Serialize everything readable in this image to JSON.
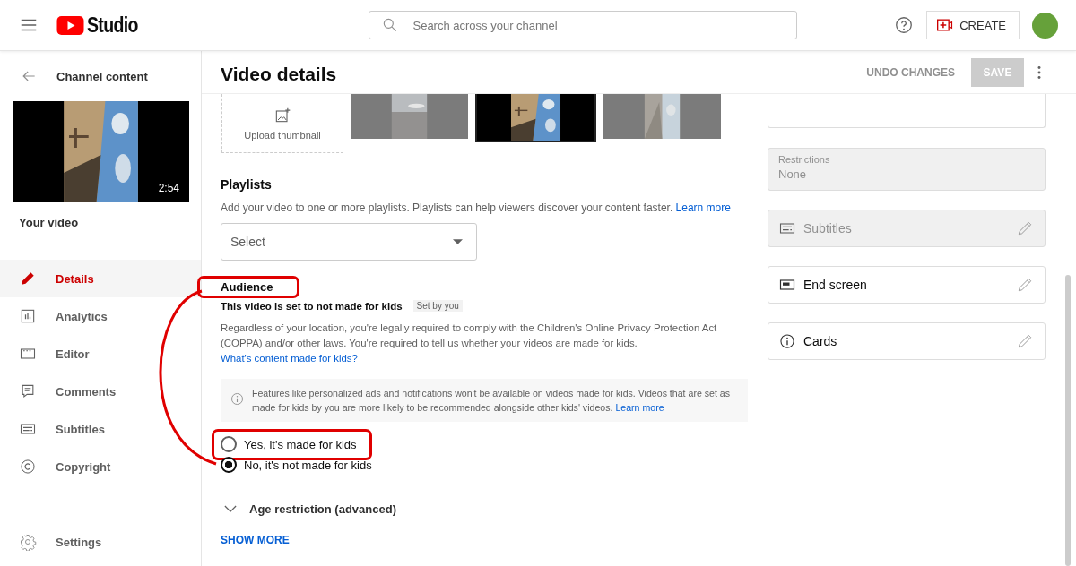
{
  "header": {
    "logo_text": "Studio",
    "search": {
      "placeholder": "Search across your channel"
    },
    "create_label": "CREATE"
  },
  "sidebar": {
    "back_label": "Channel content",
    "video": {
      "duration": "2:54",
      "label": "Your video"
    },
    "items": [
      {
        "label": "Details",
        "kind": "pencil",
        "selected": true
      },
      {
        "label": "Analytics",
        "kind": "analytics",
        "selected": false
      },
      {
        "label": "Editor",
        "kind": "editor",
        "selected": false
      },
      {
        "label": "Comments",
        "kind": "comments",
        "selected": false
      },
      {
        "label": "Subtitles",
        "kind": "subtitles",
        "selected": false
      },
      {
        "label": "Copyright",
        "kind": "copyright",
        "selected": false
      }
    ],
    "settings": {
      "label": "Settings"
    }
  },
  "page": {
    "title": "Video details",
    "undo_label": "UNDO CHANGES",
    "save": {
      "label": "SAVE",
      "disabled": true
    }
  },
  "thumbnails": {
    "upload_label": "Upload thumbnail",
    "options": [
      {
        "selected": false
      },
      {
        "selected": true
      },
      {
        "selected": false
      }
    ]
  },
  "playlists": {
    "title": "Playlists",
    "description": "Add your video to one or more playlists. Playlists can help viewers discover your content faster.",
    "link": "Learn more",
    "select_label": "Select"
  },
  "audience": {
    "title": "Audience",
    "highlighted": true,
    "status": "This video is set to not made for kids",
    "status_badge": "Set by you",
    "description": "Regardless of your location, you're legally required to comply with the Children's Online Privacy Protection Act (COPPA) and/or other laws. You're required to tell us whether your videos are made for kids.",
    "description_link": "What's content made for kids?",
    "notice": "Features like personalized ads and notifications won't be available on videos made for kids. Videos that are set as made for kids by you are more likely to be recommended alongside other kids' videos.",
    "notice_link": "Learn more",
    "options": [
      {
        "label": "Yes, it's made for kids",
        "selected": false,
        "highlighted": true
      },
      {
        "label": "No, it's not made for kids",
        "selected": true,
        "highlighted": false
      }
    ]
  },
  "age_restriction": {
    "label": "Age restriction (advanced)",
    "expanded": false
  },
  "show_more": "SHOW MORE",
  "side_panel": {
    "restrictions": {
      "label": "Restrictions",
      "value": "None"
    },
    "items": [
      {
        "label": "Subtitles",
        "kind": "subtitles",
        "disabled": true
      },
      {
        "label": "End screen",
        "kind": "endscreen",
        "disabled": false
      },
      {
        "label": "Cards",
        "kind": "info",
        "disabled": false
      }
    ]
  }
}
